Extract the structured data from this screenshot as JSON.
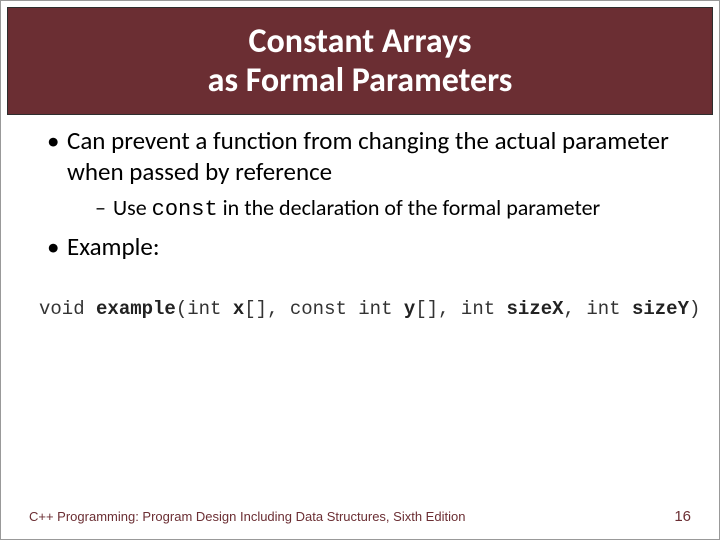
{
  "title": "Constant Arrays\nas Formal Parameters",
  "bullets": {
    "b1": "Can prevent a function from changing the actual parameter when passed by reference",
    "b1_sub_pre": "Use ",
    "b1_sub_code": "const",
    "b1_sub_post": " in the declaration of the formal parameter",
    "b2": "Example:"
  },
  "code": {
    "t1": "void ",
    "t2": "example",
    "t3": "(int ",
    "t4": "x",
    "t5": "[], const int ",
    "t6": "y",
    "t7": "[], int ",
    "t8": "sizeX",
    "t9": ", int ",
    "t10": "sizeY",
    "t11": ")"
  },
  "footer": {
    "left": "C++ Programming: Program Design Including Data Structures, Sixth Edition",
    "page": "16"
  }
}
